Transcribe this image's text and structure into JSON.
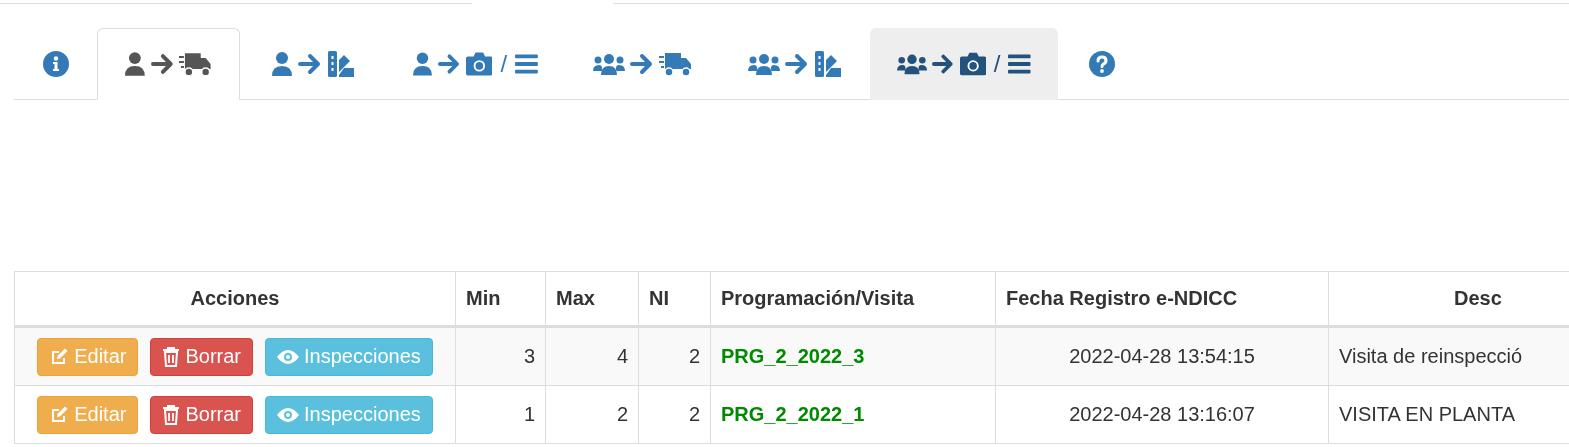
{
  "tabs": [
    {
      "kind": "info",
      "selected": false,
      "highlighted": false
    },
    {
      "kind": "person-truck",
      "selected": true,
      "highlighted": false
    },
    {
      "kind": "person-swatch",
      "selected": false,
      "highlighted": false
    },
    {
      "kind": "person-camera",
      "separator": "/",
      "selected": false,
      "highlighted": false
    },
    {
      "kind": "group-truck",
      "selected": false,
      "highlighted": false
    },
    {
      "kind": "group-swatch",
      "selected": false,
      "highlighted": false
    },
    {
      "kind": "group-camera",
      "separator": "/",
      "selected": false,
      "highlighted": true
    },
    {
      "kind": "help",
      "selected": false,
      "highlighted": false
    }
  ],
  "table": {
    "columns": [
      "Acciones",
      "Min",
      "Max",
      "NI",
      "Programación/Visita",
      "Fecha Registro e-NDICC",
      "Desc"
    ],
    "rows": [
      {
        "actions": [
          {
            "kind": "edit",
            "label": "Editar"
          },
          {
            "kind": "delete",
            "label": "Borrar"
          },
          {
            "kind": "view",
            "label": "Inspecciones"
          }
        ],
        "min": "3",
        "max": "4",
        "ni": "2",
        "program": "PRG_2_2022_3",
        "date": "2022-04-28 13:54:15",
        "description": "Visita de reinspecció"
      },
      {
        "actions": [
          {
            "kind": "edit",
            "label": "Editar"
          },
          {
            "kind": "delete",
            "label": "Borrar"
          },
          {
            "kind": "view",
            "label": "Inspecciones"
          }
        ],
        "min": "1",
        "max": "2",
        "ni": "2",
        "program": "PRG_2_2022_1",
        "date": "2022-04-28 13:16:07",
        "description": "VISITA EN PLANTA"
      }
    ]
  }
}
